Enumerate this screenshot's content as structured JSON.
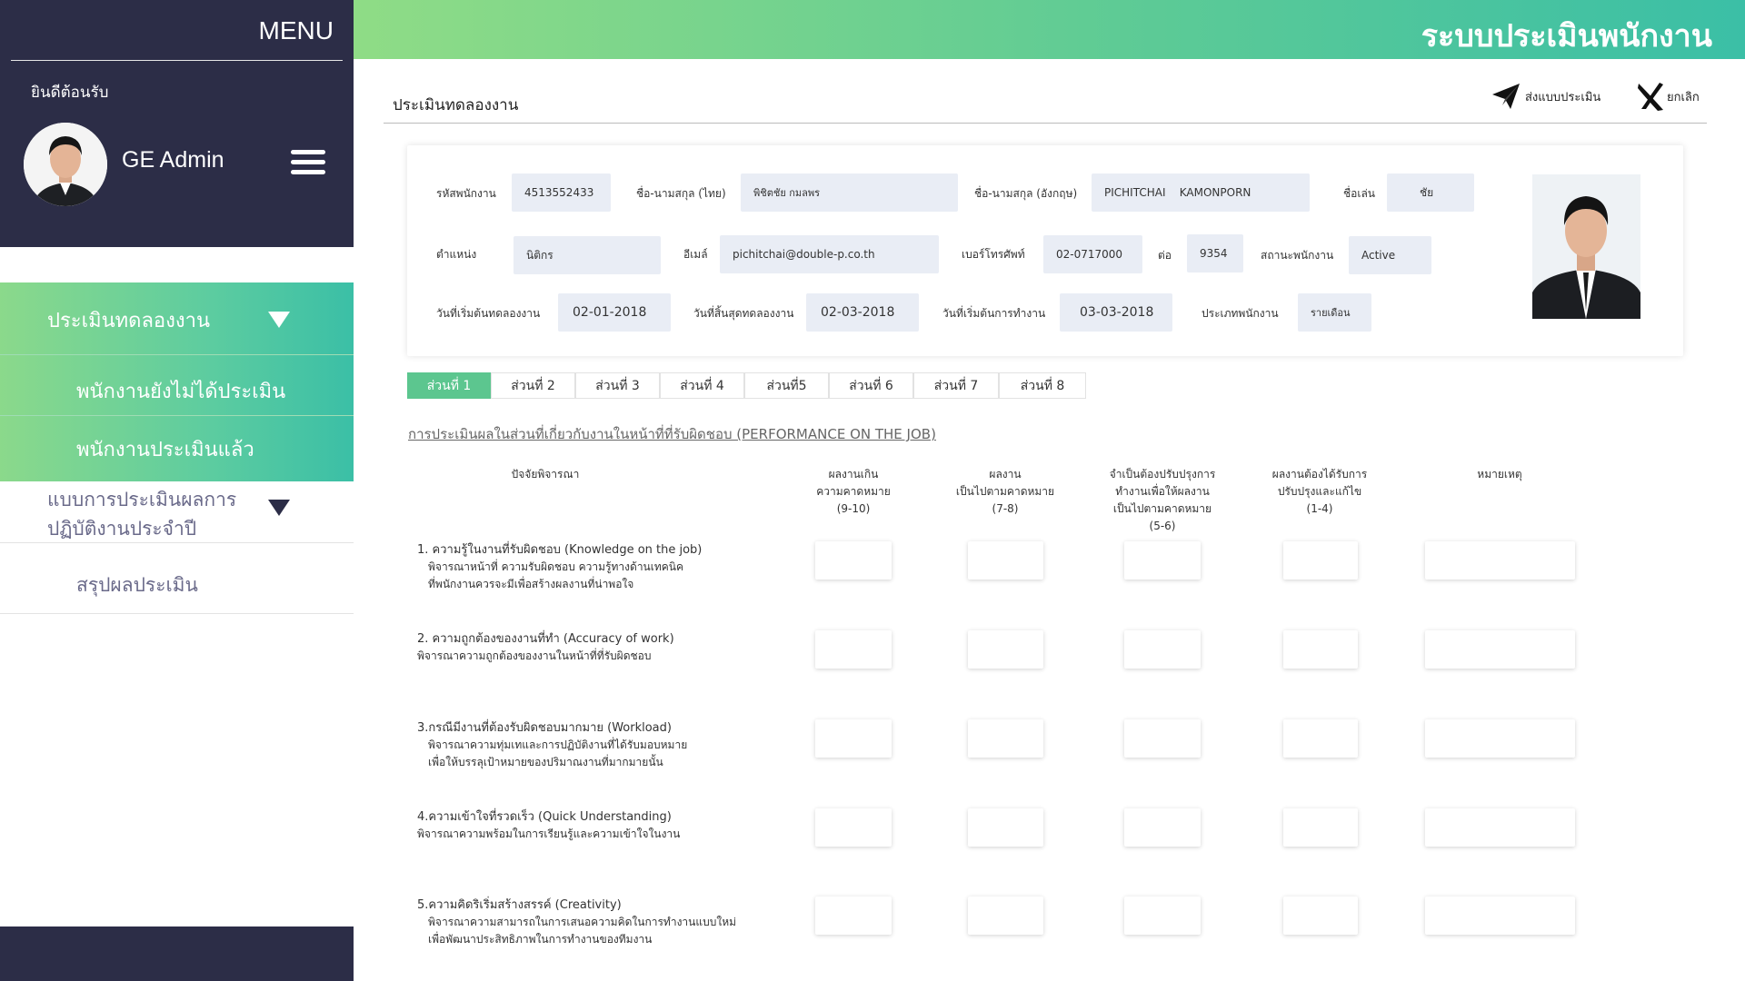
{
  "sidebar": {
    "menu_title": "MENU",
    "welcome": "ยินดีต้อนรับ",
    "user_name": "GE Admin",
    "nav": [
      {
        "label": "ประเมินทดลองงาน"
      },
      {
        "label": "พนักงานยังไม่ได้ประเมิน"
      },
      {
        "label": "พนักงานประเมินแล้ว"
      },
      {
        "label_line1": "แบบการประเมินผลการ",
        "label_line2": "ปฏิบัติงานประจำปี"
      },
      {
        "label": "สรุปผลประเมิน"
      }
    ]
  },
  "header": {
    "app_title": "ระบบประเมินพนักงาน"
  },
  "page": {
    "title": "ประเมินทดลองงาน",
    "send_label": "ส่งแบบประเมิน",
    "cancel_label": "ยกเลิก"
  },
  "employee": {
    "id_label": "รหัสพนักงาน",
    "id": "4513552433",
    "name_th_label": "ชื่อ-นามสกุล (ไทย)",
    "name_th": "พิชิตชัย   กมลพร",
    "name_en_label": "ชื่อ-นามสกุล (อังกฤษ)",
    "name_en": "PICHITCHAI    KAMONPORN",
    "nickname_label": "ชื่อเล่น",
    "nickname": "ชัย",
    "position_label": "ตำแหน่ง",
    "position": "นิติกร",
    "email_label": "อีเมล์",
    "email": "pichitchai@double-p.co.th",
    "phone_label": "เบอร์โทรศัพท์",
    "phone": "02-0717000",
    "ext_label": "ต่อ",
    "ext": "9354",
    "status_label": "สถานะพนักงาน",
    "status": "Active",
    "probation_start_label": "วันที่เริ่มต้นทดลองงาน",
    "probation_start": "02-01-2018",
    "probation_end_label": "วันที่สิ้นสุดทดลองงาน",
    "probation_end": "02-03-2018",
    "work_start_label": "วันที่เริ่มต้นการทำงาน",
    "work_start": "03-03-2018",
    "emp_type_label": "ประเภทพนักงาน",
    "emp_type": "รายเดือน"
  },
  "tabs": [
    "ส่วนที่ 1",
    "ส่วนที่ 2",
    "ส่วนที่  3",
    "ส่วนที่ 4",
    "ส่วนที่5",
    "ส่วนที่ 6",
    "ส่วนที่ 7",
    "ส่วนที่ 8"
  ],
  "section_title": "การประเมินผลในส่วนที่เกี่ยวกับงานในหน้าที่ที่รับผิดชอบ (PERFORMANCE ON THE JOB)",
  "table_headers": {
    "criteria": "ปัจจัยพิจารณา",
    "col1": [
      "ผลงานเกิน",
      "ความคาดหมาย",
      "(9-10)"
    ],
    "col2": [
      "ผลงาน",
      "เป็นไปตามคาดหมาย",
      "(7-8)"
    ],
    "col3": [
      "จำเป็นต้องปรับปรุงการ",
      "ทำงานเพื่อให้ผลงาน",
      "เป็นไปตามคาดหมาย",
      "(5-6)"
    ],
    "col4": [
      "ผลงานต้องได้รับการ",
      "ปรับปรุงและแก้ไข",
      "(1-4)"
    ],
    "remark": "หมายเหตุ"
  },
  "criteria": [
    {
      "title": "1. ความรู้ในงานที่รับผิดชอบ (Knowledge on the job)",
      "desc": [
        "พิจารณาหน้าที่ ความรับผิดชอบ ความรู้ทางด้านเทคนิค",
        "ที่พนักงานควรจะมีเพื่อสร้างผลงานที่น่าพอใจ"
      ]
    },
    {
      "title": "2. ความถูกต้องของงานที่ทำ (Accuracy of work)",
      "desc": [
        "พิจารณาความถูกต้องของงานในหน้าที่ที่รับผิดชอบ"
      ]
    },
    {
      "title": "3.กรณีมีงานที่ต้องรับผิดชอบมากมาย (Workload)",
      "desc": [
        "พิจารณาความทุ่มเทและการปฏิบัติงานที่ได้รับมอบหมาย",
        "เพื่อให้บรรลุเป้าหมายของปริมาณงานที่มากมายนั้น"
      ]
    },
    {
      "title": "4.ความเข้าใจที่รวดเร็ว (Quick Understanding)",
      "desc": [
        "พิจารณาความพร้อมในการเรียนรู้และความเข้าใจในงาน"
      ]
    },
    {
      "title": "5.ความคิดริเริ่มสร้างสรรค์ (Creativity)",
      "desc": [
        "พิจารณาความสามารถในการเสนอความคิดในการทำงานแบบใหม่",
        "เพื่อพัฒนาประสิทธิภาพในการทำงานของทีมงาน"
      ]
    }
  ],
  "icons": {
    "send": "paper-plane-icon",
    "cancel": "x-close-icon",
    "menu": "hamburger-menu-icon",
    "expand": "triangle-down-icon"
  },
  "colors": {
    "sidebar_dark": "#2c2d47",
    "accent_green": "#5cc68f",
    "accent_teal": "#3bbfa6",
    "field_bg": "#e9edf5"
  }
}
